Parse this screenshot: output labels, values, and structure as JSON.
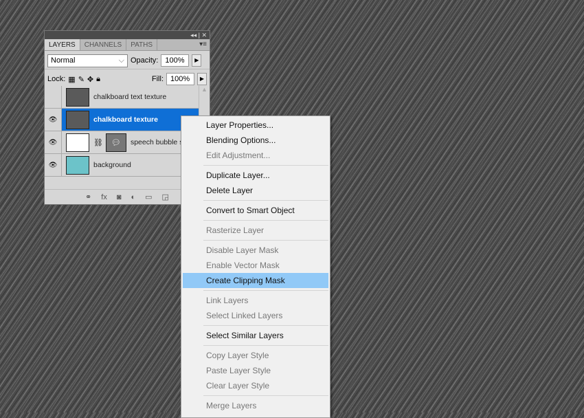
{
  "panel": {
    "title_controls": "◂◂ | ✕",
    "tabs": [
      "LAYERS",
      "CHANNELS",
      "PATHS"
    ],
    "blend_mode": "Normal",
    "opacity_label": "Opacity:",
    "opacity": "100%",
    "lock_label": "Lock:",
    "fill_label": "Fill:",
    "fill": "100%",
    "layers": [
      {
        "name": "chalkboard text texture",
        "visible": false,
        "selected": false,
        "thumb_color": "#5a5a5a"
      },
      {
        "name": "chalkboard texture",
        "visible": true,
        "selected": true,
        "thumb_color": "#5a5a5a"
      },
      {
        "name": "speech bubble sha",
        "visible": true,
        "selected": false,
        "thumb_color": "#ffffff"
      },
      {
        "name": "background",
        "visible": true,
        "selected": false,
        "thumb_color": "#6cc3c9"
      }
    ],
    "footer_icons": [
      "link-icon",
      "fx-icon",
      "mask-icon",
      "adjustment-icon",
      "folder-icon",
      "new-layer-icon"
    ]
  },
  "context_menu": {
    "highlight_color": "#91c9f7",
    "groups": [
      [
        {
          "label": "Layer Properties...",
          "enabled": true
        },
        {
          "label": "Blending Options...",
          "enabled": true
        },
        {
          "label": "Edit Adjustment...",
          "enabled": false
        }
      ],
      [
        {
          "label": "Duplicate Layer...",
          "enabled": true
        },
        {
          "label": "Delete Layer",
          "enabled": true
        }
      ],
      [
        {
          "label": "Convert to Smart Object",
          "enabled": true
        }
      ],
      [
        {
          "label": "Rasterize Layer",
          "enabled": false
        }
      ],
      [
        {
          "label": "Disable Layer Mask",
          "enabled": false
        },
        {
          "label": "Enable Vector Mask",
          "enabled": false
        },
        {
          "label": "Create Clipping Mask",
          "enabled": true,
          "highlighted": true
        }
      ],
      [
        {
          "label": "Link Layers",
          "enabled": false
        },
        {
          "label": "Select Linked Layers",
          "enabled": false
        }
      ],
      [
        {
          "label": "Select Similar Layers",
          "enabled": true
        }
      ],
      [
        {
          "label": "Copy Layer Style",
          "enabled": false
        },
        {
          "label": "Paste Layer Style",
          "enabled": false
        },
        {
          "label": "Clear Layer Style",
          "enabled": false
        }
      ],
      [
        {
          "label": "Merge Layers",
          "enabled": false
        }
      ]
    ]
  }
}
